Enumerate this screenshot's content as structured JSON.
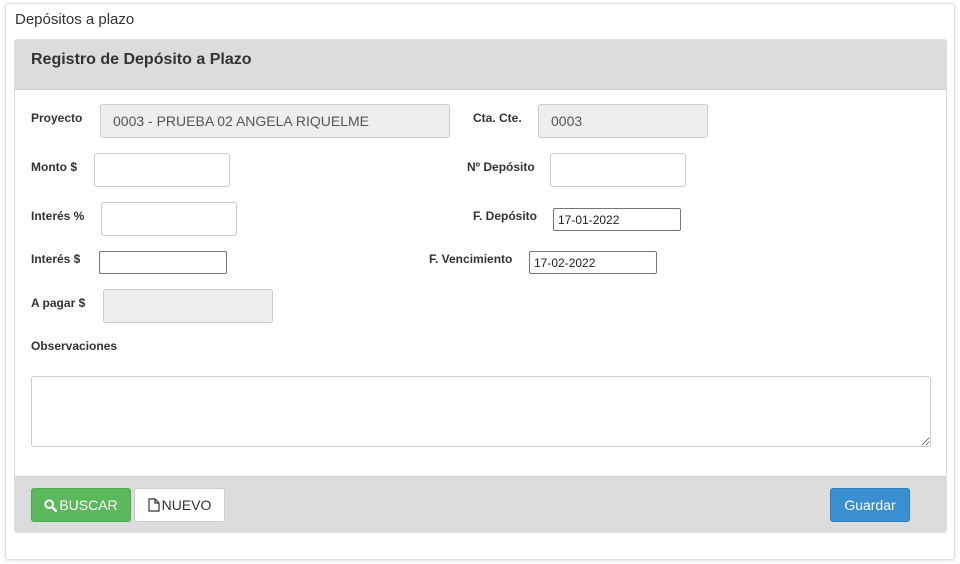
{
  "page": {
    "title": "Depósitos a plazo"
  },
  "panel": {
    "title": "Registro de Depósito a Plazo"
  },
  "form": {
    "proyecto": {
      "label": "Proyecto",
      "value": "0003 - PRUEBA 02 ANGELA RIQUELME"
    },
    "cta_cte": {
      "label": "Cta. Cte.",
      "value": "0003"
    },
    "monto": {
      "label": "Monto $",
      "value": ""
    },
    "n_deposito": {
      "label": "Nº Depósito",
      "value": ""
    },
    "interes_pct": {
      "label": "Interés %",
      "value": ""
    },
    "f_deposito": {
      "label": "F. Depósito",
      "value": "17-01-2022"
    },
    "interes_monto": {
      "label": "Interés $",
      "value": ""
    },
    "f_vencimiento": {
      "label": "F. Vencimiento",
      "value": "17-02-2022"
    },
    "a_pagar": {
      "label": "A pagar $",
      "value": ""
    },
    "observaciones": {
      "label": "Observaciones",
      "value": ""
    }
  },
  "footer": {
    "buscar_label": "BUSCAR",
    "nuevo_label": "NUEVO",
    "guardar_label": "Guardar"
  },
  "icons": {
    "buscar": "search-icon",
    "nuevo": "file-icon",
    "textarea_resize": "resize-grip-icon"
  },
  "colors": {
    "panel_header_bg": "#dcdcdc",
    "success": "#5cb85c",
    "primary": "#3a8fd1",
    "readonly_bg": "#eeeeee"
  }
}
